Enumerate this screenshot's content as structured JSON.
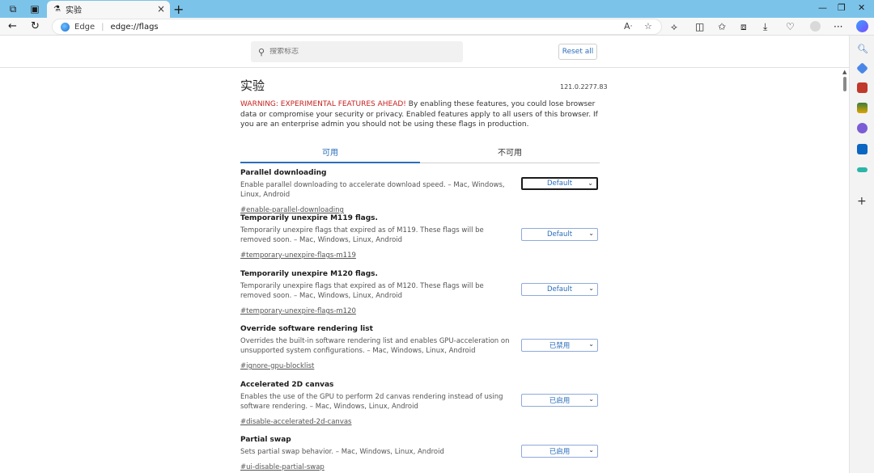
{
  "browser": {
    "tab_title": "实验",
    "address_label": "Edge",
    "url": "edge://flags"
  },
  "search": {
    "placeholder": "搜索标志"
  },
  "reset_all_label": "Reset all",
  "page": {
    "title": "实验",
    "version": "121.0.2277.83",
    "warning_red": "WARNING: EXPERIMENTAL FEATURES AHEAD!",
    "warning_text": " By enabling these features, you could lose browser data or compromise your security or privacy. Enabled features apply to all users of this browser. If you are an enterprise admin you should not be using these flags in production."
  },
  "tabs": {
    "available": "可用",
    "unavailable": "不可用"
  },
  "flags": [
    {
      "title": "Parallel downloading",
      "desc": "Enable parallel downloading to accelerate download speed. – Mac, Windows, Linux, Android",
      "link": "#enable-parallel-downloading",
      "value": "Default"
    },
    {
      "title": "Temporarily unexpire M119 flags.",
      "desc": "Temporarily unexpire flags that expired as of M119. These flags will be removed soon. – Mac, Windows, Linux, Android",
      "link": "#temporary-unexpire-flags-m119",
      "value": "Default"
    },
    {
      "title": "Temporarily unexpire M120 flags.",
      "desc": "Temporarily unexpire flags that expired as of M120. These flags will be removed soon. – Mac, Windows, Linux, Android",
      "link": "#temporary-unexpire-flags-m120",
      "value": "Default"
    },
    {
      "title": "Override software rendering list",
      "desc": "Overrides the built-in software rendering list and enables GPU-acceleration on unsupported system configurations. – Mac, Windows, Linux, Android",
      "link": "#ignore-gpu-blocklist",
      "value": "已禁用"
    },
    {
      "title": "Accelerated 2D canvas",
      "desc": "Enables the use of the GPU to perform 2d canvas rendering instead of using software rendering. – Mac, Windows, Linux, Android",
      "link": "#disable-accelerated-2d-canvas",
      "value": "已启用"
    },
    {
      "title": "Partial swap",
      "desc": "Sets partial swap behavior. – Mac, Windows, Linux, Android",
      "link": "#ui-disable-partial-swap",
      "value": "已启用"
    }
  ]
}
